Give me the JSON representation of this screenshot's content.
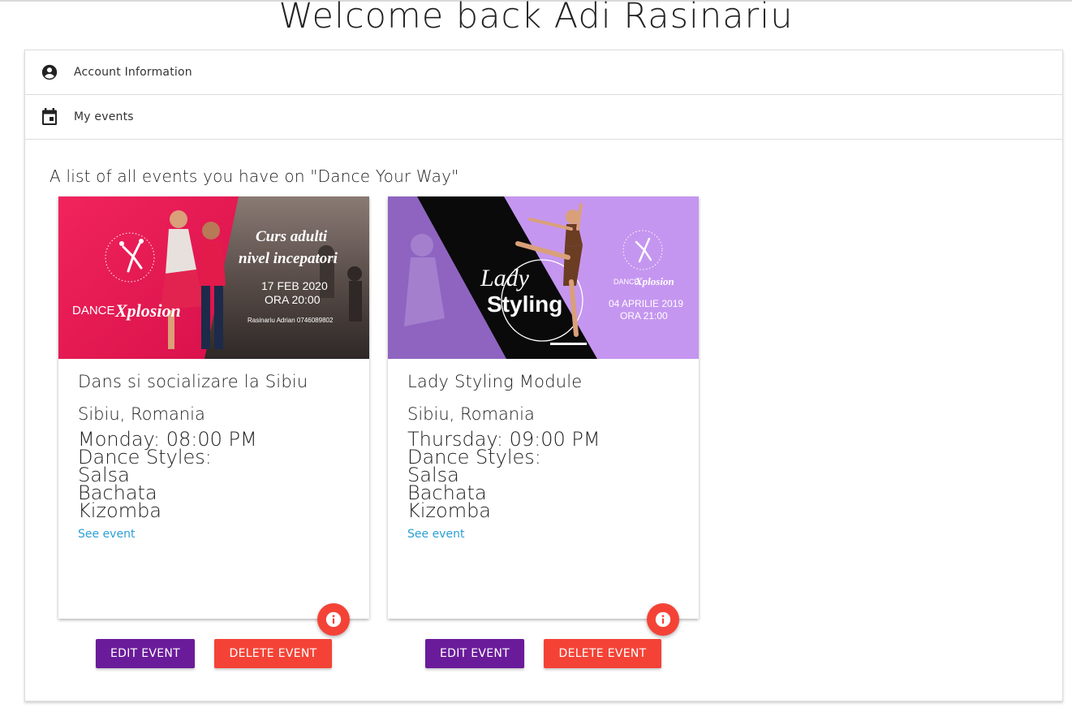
{
  "page": {
    "title": "Welcome back Adi Rasinariu"
  },
  "accordion": {
    "items": [
      {
        "label": "Account Information",
        "icon": "account-circle-icon"
      },
      {
        "label": "My events",
        "icon": "calendar-event-icon"
      }
    ]
  },
  "events_section": {
    "heading": "A list of all events you have on \"Dance Your Way\""
  },
  "events": [
    {
      "title": "Dans si socializare la Sibiu",
      "location": "Sibiu, Romania",
      "schedule": "Monday: 08:00 PM",
      "styles_label": "Dance Styles:",
      "styles": [
        "Salsa",
        "Bachata",
        "Kizomba"
      ],
      "link_label": "See event",
      "edit_label": "EDIT EVENT",
      "delete_label": "DELETE EVENT",
      "poster": {
        "headline_1": "Curs adulti",
        "headline_2": "nivel incepatori",
        "date": "17 FEB 2020",
        "time": "ORA 20:00",
        "contact": "Rasinariu Adrian 0746089802",
        "brand_a": "DANCE",
        "brand_b": "Xplosion"
      }
    },
    {
      "title": "Lady Styling Module",
      "location": "Sibiu, Romania",
      "schedule": "Thursday: 09:00 PM",
      "styles_label": "Dance Styles:",
      "styles": [
        "Salsa",
        "Bachata",
        "Kizomba"
      ],
      "link_label": "See event",
      "edit_label": "EDIT EVENT",
      "delete_label": "DELETE EVENT",
      "poster": {
        "headline_1": "Lady",
        "headline_2": "Styling",
        "date": "04 APRILIE 2019",
        "time": "ORA 21:00",
        "brand_a": "DANCE",
        "brand_b": "Xplosion"
      }
    }
  ],
  "colors": {
    "edit_button": "#6a1b9a",
    "delete_button": "#f44336",
    "info_fab": "#f44336",
    "link": "#2a9fd6"
  }
}
